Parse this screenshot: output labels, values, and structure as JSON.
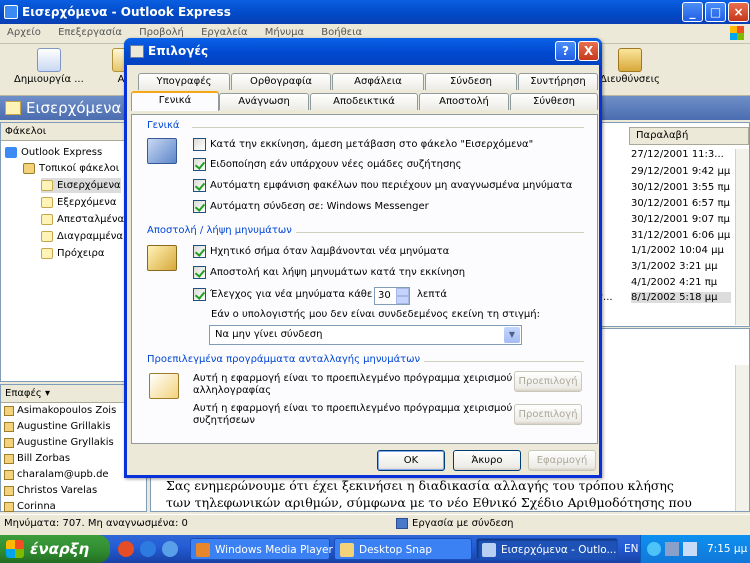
{
  "window": {
    "title": "Εισερχόμενα - Outlook Express"
  },
  "menu": [
    "Αρχείο",
    "Επεξεργασία",
    "Προβολή",
    "Εργαλεία",
    "Μήνυμα",
    "Βοήθεια"
  ],
  "toolbar": {
    "create_mail": "Δημιουργία ...",
    "reply_partial": "Απ",
    "addresses": "Διευθύνσεις"
  },
  "folder_bar": {
    "title": "Εισερχόμενα"
  },
  "folders": {
    "header": "Φάκελοι",
    "items": [
      "Outlook Express",
      "Τοπικοί φάκελοι",
      "Εισερχόμενα",
      "Εξερχόμενα",
      "Απεσταλμένα",
      "Διαγραμμένα",
      "Πρόχειρα"
    ]
  },
  "contacts": {
    "header": "Επαφές",
    "items": [
      "Asimakopoulos Zois",
      "Augustine Grillakis",
      "Augustine Gryllakis",
      "Bill Zorbas",
      "charalam@upb.de",
      "Christos Varelas",
      "Corinna"
    ]
  },
  "message_list": {
    "received_header": "Παραλαβή",
    "dates": [
      "27/12/2001 11:3...",
      "29/12/2001 9:42 μμ",
      "30/12/2001 3:55 πμ",
      "30/12/2001 6:57 πμ",
      "30/12/2001 9:07 πμ",
      "31/12/2001 6:06 μμ",
      "1/1/2002 10:04 μμ",
      "3/1/2002 3:21 μμ",
      "4/1/2002 4:21 πμ",
      "8/1/2002 5:18 μμ"
    ],
    "truncated_mark": "τ..."
  },
  "preview": {
    "lines": [
      "Σας ενημερώνουμε ότι έχει ξεκινήσει η διαδικασία αλλαγής του τρόπου κλήσης",
      "των τηλεφωνικών αριθμών, σύμφωνα με το νέο Εθνικό Σχέδιο Αριθμοδότησης που"
    ]
  },
  "status": {
    "messages": "Μηνύματα: 707. Μη αναγνωσμένα: 0",
    "connection": "Εργασία με σύνδεση"
  },
  "taskbar": {
    "start": "έναρξη",
    "tasks": [
      "Windows Media Player",
      "Desktop Snap",
      "Εισερχόμενα - Outlo..."
    ],
    "lang": "EN",
    "clock": "7:15 μμ"
  },
  "dialog": {
    "title": "Επιλογές",
    "help_button": "?",
    "close_button": "X",
    "tabs_top": [
      "Υπογραφές",
      "Ορθογραφία",
      "Ασφάλεια",
      "Σύνδεση",
      "Συντήρηση"
    ],
    "tabs_bottom": [
      "Γενικά",
      "Ανάγνωση",
      "Αποδεικτικά",
      "Αποστολή",
      "Σύνθεση"
    ],
    "general_group": "Γενικά",
    "general_options": [
      {
        "label": "Κατά την εκκίνηση, άμεση μετάβαση στο φάκελο \"Εισερχόμενα\"",
        "checked": false
      },
      {
        "label": "Ειδοποίηση εάν υπάρχουν νέες ομάδες συζήτησης",
        "checked": true
      },
      {
        "label": "Αυτόματη εμφάνιση φακέλων που περιέχουν μη αναγνωσμένα μηνύματα",
        "checked": true
      },
      {
        "label": "Αυτόματη σύνδεση σε:  Windows Messenger",
        "checked": true
      }
    ],
    "send_group": "Αποστολή / λήψη μηνυμάτων",
    "send_options": [
      {
        "label": "Ηχητικό σήμα όταν λαμβάνονται νέα μηνύματα",
        "checked": true
      },
      {
        "label": "Αποστολή και λήψη μηνυμάτων κατά την εκκίνηση",
        "checked": true
      },
      {
        "label": "Έλεγχος για νέα μηνύματα κάθε",
        "checked": true
      }
    ],
    "interval_value": "30",
    "interval_unit": "λεπτά",
    "offline_label": "Εάν ο υπολογιστής μου δεν είναι συνδεδεμένος εκείνη τη στιγμή:",
    "offline_option": "Να μην γίνει σύνδεση",
    "default_group": "Προεπιλεγμένα προγράμματα ανταλλαγής μηνυμάτων",
    "default_mail_text": [
      "Αυτή η εφαρμογή είναι το προεπιλεγμένο πρόγραμμα χειρισμού",
      "αλληλογραφίας"
    ],
    "default_news_text": [
      "Αυτή η εφαρμογή είναι το προεπιλεγμένο πρόγραμμα χειρισμού",
      "συζητήσεων"
    ],
    "make_default": "Προεπιλογή",
    "ok": "OK",
    "cancel": "Άκυρο",
    "apply": "Εφαρμογή"
  }
}
